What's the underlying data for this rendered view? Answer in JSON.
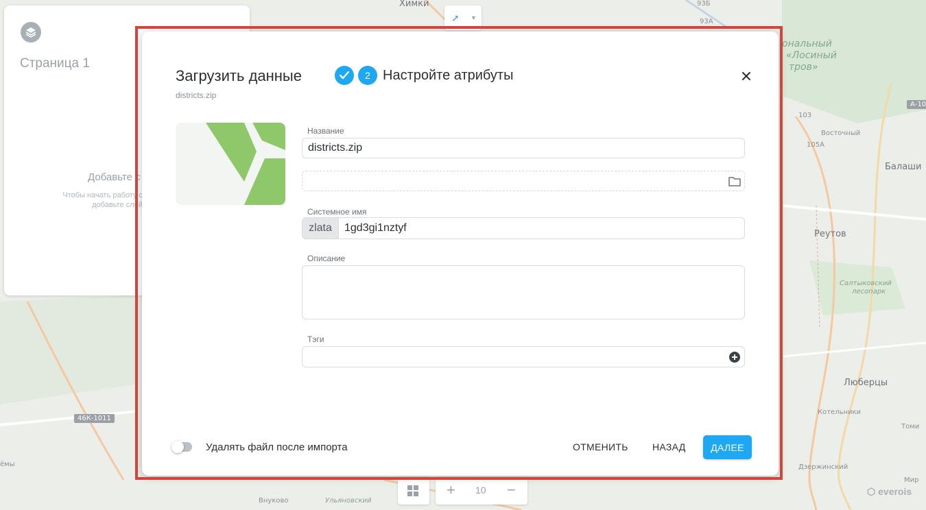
{
  "map": {
    "labels": {
      "khimki": "Химки",
      "natsional": "ональный",
      "losiny": "«Лосиный",
      "ostrov": "тров»",
      "vostochny": "Восточный",
      "balashi": "Балаши",
      "reutov": "Реутов",
      "saltykovsky": "Салтыковский",
      "lesopark": "лесопарк",
      "lyubertsy": "Люберцы",
      "kotelniki": "Котельники",
      "tomi": "Томи",
      "dzerzhinsky": "Дзержинский",
      "vnukovo": "Внуково",
      "emy": "ёмы",
      "ulyanovsky": "Ульяновский",
      "mir": "Мир"
    },
    "badges": {
      "a10": "А-10",
      "r46k": "46К-1011",
      "r93b": "93Б",
      "r93a": "93А",
      "r103": "103",
      "r105a": "105А"
    }
  },
  "page_panel": {
    "title": "Страница 1",
    "add_title": "Добавьте с",
    "add_hint_line1": "Чтобы начать работу с",
    "add_hint_line2": "добавьте слой"
  },
  "bottom_toolbar": {
    "zoom_level": "10"
  },
  "brand": "everois",
  "modal": {
    "title": "Загрузить данные",
    "file_name": "districts.zip",
    "step_number": "2",
    "step_label": "Настройте атрибуты",
    "fields": {
      "name_label": "Название",
      "name_value": "districts.zip",
      "system_name_label": "Системное имя",
      "system_prefix": "zlata",
      "system_name_value": "1gd3gi1nztyf",
      "description_label": "Описание",
      "description_value": "",
      "tags_label": "Тэги",
      "tags_value": ""
    },
    "toggle": {
      "label": "Удалять файл после импорта",
      "enabled": false
    },
    "buttons": {
      "cancel": "ОТМЕНИТЬ",
      "back": "НАЗАД",
      "next": "ДАЛЕЕ"
    },
    "colors": {
      "accent": "#1ea7f2",
      "thumbnail_green": "#8fc86a",
      "highlight": "#d2453a"
    }
  }
}
